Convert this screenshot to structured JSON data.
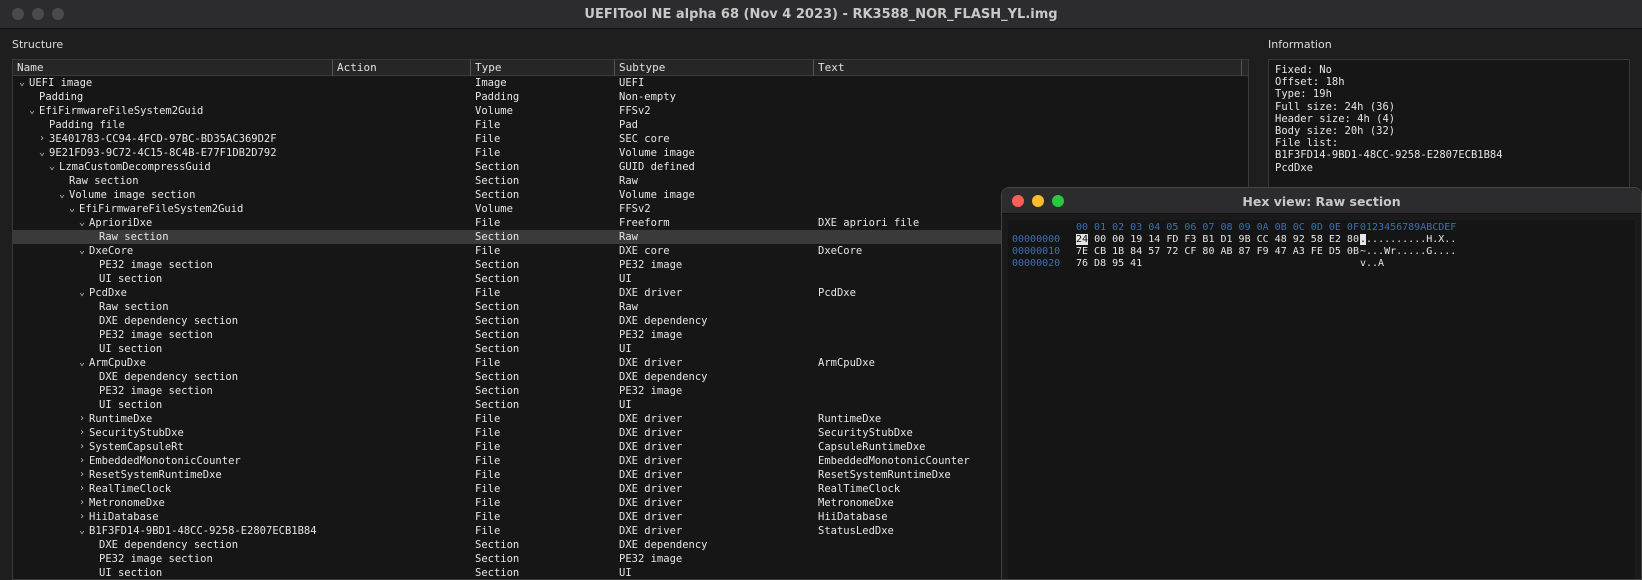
{
  "window": {
    "title": "UEFITool NE alpha 68 (Nov  4 2023) - RK3588_NOR_FLASH_YL.img"
  },
  "structure": {
    "label": "Structure",
    "columns": [
      "Name",
      "Action",
      "Type",
      "Subtype",
      "Text"
    ],
    "rows": [
      {
        "name": "UEFI image",
        "type": "Image",
        "subtype": "UEFI",
        "text": "",
        "level": 0,
        "exp": "open"
      },
      {
        "name": "Padding",
        "type": "Padding",
        "subtype": "Non-empty",
        "text": "",
        "level": 1,
        "exp": ""
      },
      {
        "name": "EfiFirmwareFileSystem2Guid",
        "type": "Volume",
        "subtype": "FFSv2",
        "text": "",
        "level": 1,
        "exp": "open"
      },
      {
        "name": "Padding file",
        "type": "File",
        "subtype": "Pad",
        "text": "",
        "level": 2,
        "exp": ""
      },
      {
        "name": "3E401783-CC94-4FCD-97BC-BD35AC369D2F",
        "type": "File",
        "subtype": "SEC core",
        "text": "",
        "level": 2,
        "exp": "closed"
      },
      {
        "name": "9E21FD93-9C72-4C15-8C4B-E77F1DB2D792",
        "type": "File",
        "subtype": "Volume image",
        "text": "",
        "level": 2,
        "exp": "open"
      },
      {
        "name": "LzmaCustomDecompressGuid",
        "type": "Section",
        "subtype": "GUID defined",
        "text": "",
        "level": 3,
        "exp": "open"
      },
      {
        "name": "Raw section",
        "type": "Section",
        "subtype": "Raw",
        "text": "",
        "level": 4,
        "exp": ""
      },
      {
        "name": "Volume image section",
        "type": "Section",
        "subtype": "Volume image",
        "text": "",
        "level": 4,
        "exp": "open"
      },
      {
        "name": "EfiFirmwareFileSystem2Guid",
        "type": "Volume",
        "subtype": "FFSv2",
        "text": "",
        "level": 5,
        "exp": "open"
      },
      {
        "name": "AprioriDxe",
        "type": "File",
        "subtype": "Freeform",
        "text": "DXE apriori file",
        "level": 6,
        "exp": "open"
      },
      {
        "name": "Raw section",
        "type": "Section",
        "subtype": "Raw",
        "text": "",
        "level": 7,
        "exp": "",
        "selected": true
      },
      {
        "name": "DxeCore",
        "type": "File",
        "subtype": "DXE core",
        "text": "DxeCore",
        "level": 6,
        "exp": "open"
      },
      {
        "name": "PE32 image section",
        "type": "Section",
        "subtype": "PE32 image",
        "text": "",
        "level": 7,
        "exp": ""
      },
      {
        "name": "UI section",
        "type": "Section",
        "subtype": "UI",
        "text": "",
        "level": 7,
        "exp": ""
      },
      {
        "name": "PcdDxe",
        "type": "File",
        "subtype": "DXE driver",
        "text": "PcdDxe",
        "level": 6,
        "exp": "open"
      },
      {
        "name": "Raw section",
        "type": "Section",
        "subtype": "Raw",
        "text": "",
        "level": 7,
        "exp": ""
      },
      {
        "name": "DXE dependency section",
        "type": "Section",
        "subtype": "DXE dependency",
        "text": "",
        "level": 7,
        "exp": ""
      },
      {
        "name": "PE32 image section",
        "type": "Section",
        "subtype": "PE32 image",
        "text": "",
        "level": 7,
        "exp": ""
      },
      {
        "name": "UI section",
        "type": "Section",
        "subtype": "UI",
        "text": "",
        "level": 7,
        "exp": ""
      },
      {
        "name": "ArmCpuDxe",
        "type": "File",
        "subtype": "DXE driver",
        "text": "ArmCpuDxe",
        "level": 6,
        "exp": "open"
      },
      {
        "name": "DXE dependency section",
        "type": "Section",
        "subtype": "DXE dependency",
        "text": "",
        "level": 7,
        "exp": ""
      },
      {
        "name": "PE32 image section",
        "type": "Section",
        "subtype": "PE32 image",
        "text": "",
        "level": 7,
        "exp": ""
      },
      {
        "name": "UI section",
        "type": "Section",
        "subtype": "UI",
        "text": "",
        "level": 7,
        "exp": ""
      },
      {
        "name": "RuntimeDxe",
        "type": "File",
        "subtype": "DXE driver",
        "text": "RuntimeDxe",
        "level": 6,
        "exp": "closed"
      },
      {
        "name": "SecurityStubDxe",
        "type": "File",
        "subtype": "DXE driver",
        "text": "SecurityStubDxe",
        "level": 6,
        "exp": "closed"
      },
      {
        "name": "SystemCapsuleRt",
        "type": "File",
        "subtype": "DXE driver",
        "text": "CapsuleRuntimeDxe",
        "level": 6,
        "exp": "closed"
      },
      {
        "name": "EmbeddedMonotonicCounter",
        "type": "File",
        "subtype": "DXE driver",
        "text": "EmbeddedMonotonicCounter",
        "level": 6,
        "exp": "closed"
      },
      {
        "name": "ResetSystemRuntimeDxe",
        "type": "File",
        "subtype": "DXE driver",
        "text": "ResetSystemRuntimeDxe",
        "level": 6,
        "exp": "closed"
      },
      {
        "name": "RealTimeClock",
        "type": "File",
        "subtype": "DXE driver",
        "text": "RealTimeClock",
        "level": 6,
        "exp": "closed"
      },
      {
        "name": "MetronomeDxe",
        "type": "File",
        "subtype": "DXE driver",
        "text": "MetronomeDxe",
        "level": 6,
        "exp": "closed"
      },
      {
        "name": "HiiDatabase",
        "type": "File",
        "subtype": "DXE driver",
        "text": "HiiDatabase",
        "level": 6,
        "exp": "closed"
      },
      {
        "name": "B1F3FD14-9BD1-48CC-9258-E2807ECB1B84",
        "type": "File",
        "subtype": "DXE driver",
        "text": "StatusLedDxe",
        "level": 6,
        "exp": "open"
      },
      {
        "name": "DXE dependency section",
        "type": "Section",
        "subtype": "DXE dependency",
        "text": "",
        "level": 7,
        "exp": ""
      },
      {
        "name": "PE32 image section",
        "type": "Section",
        "subtype": "PE32 image",
        "text": "",
        "level": 7,
        "exp": ""
      },
      {
        "name": "UI section",
        "type": "Section",
        "subtype": "UI",
        "text": "",
        "level": 7,
        "exp": ""
      }
    ]
  },
  "information": {
    "label": "Information",
    "lines": [
      "Fixed: No",
      "Offset: 18h",
      "Type: 19h",
      "Full size: 24h (36)",
      "Header size: 4h (4)",
      "Body size: 20h (32)",
      "File list:",
      "B1F3FD14-9BD1-48CC-9258-E2807ECB1B84",
      "PcdDxe"
    ]
  },
  "hex_view": {
    "title": "Hex view: Raw section",
    "header_bytes": "00 01 02 03 04 05 06 07 08 09 0A 0B 0C 0D 0E 0F",
    "header_ascii": "0123456789ABCDEF",
    "rows": [
      {
        "offset": "00000000",
        "cursor": "24",
        "bytes": " 00 00 19 14 FD F3 B1 D1 9B CC 48 92 58 E2 80",
        "ascii_cursor": ".",
        "ascii": "..........H.X.."
      },
      {
        "offset": "00000010",
        "cursor": "",
        "bytes": "7E CB 1B 84 57 72 CF 80 AB 87 F9 47 A3 FE D5 0B",
        "ascii_cursor": "",
        "ascii": "~...Wr.....G...."
      },
      {
        "offset": "00000020",
        "cursor": "",
        "bytes": "76 D8 95 41",
        "ascii_cursor": "",
        "ascii": "v..A"
      }
    ]
  },
  "colors": {
    "traffic_close": "#fe5f57",
    "traffic_min": "#febc2e",
    "traffic_max": "#28c840",
    "hex_blue": "#3d6fb0",
    "selection": "#3a3a3a"
  }
}
